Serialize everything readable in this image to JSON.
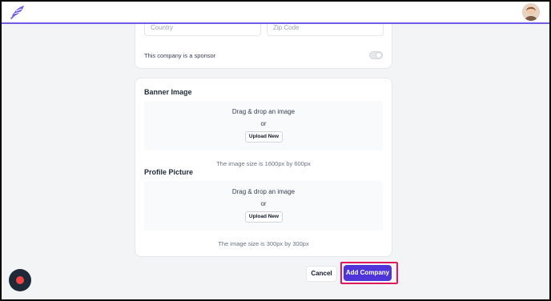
{
  "address": {
    "country_placeholder": "Country",
    "zip_placeholder": "Zip Code"
  },
  "sponsor": {
    "label": "This company is a sponsor",
    "enabled": false
  },
  "banner": {
    "title": "Banner Image",
    "drop_text": "Drag & drop an image",
    "or_text": "or",
    "upload_label": "Upload New",
    "hint": "The image size is 1600px by 600px"
  },
  "profile": {
    "title": "Profile Picture",
    "drop_text": "Drag & drop an image",
    "or_text": "or",
    "upload_label": "Upload New",
    "hint": "The image size is 300px by 300px"
  },
  "actions": {
    "cancel_label": "Cancel",
    "add_label": "Add Company"
  },
  "colors": {
    "brand": "#4f35d9",
    "highlight": "#e0195a",
    "recorder": "#ef4444"
  },
  "icons": {
    "logo": "feather-logo-icon",
    "avatar": "user-avatar",
    "recorder": "record-icon"
  }
}
